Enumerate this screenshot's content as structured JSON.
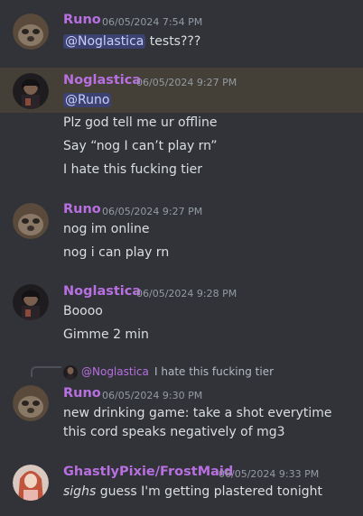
{
  "messages": [
    {
      "author": "Runo",
      "timestamp": "06/05/2024 7:54 PM",
      "mention": "@Noglastica",
      "text_after_mention": " tests???"
    },
    {
      "author": "Noglastica",
      "timestamp": "06/05/2024 9:27 PM",
      "mention": "@Runo",
      "lines": [
        "Plz god tell me ur offline",
        "Say “nog I can’t play rn”",
        "I hate this fucking tier"
      ]
    },
    {
      "author": "Runo",
      "timestamp": "06/05/2024 9:27 PM",
      "lines": [
        "nog im online",
        "nog i can play rn"
      ]
    },
    {
      "author": "Noglastica",
      "timestamp": "06/05/2024 9:28 PM",
      "lines": [
        "Boooo",
        "Gimme 2 min"
      ]
    },
    {
      "reply": {
        "author": "@Noglastica",
        "text": "I hate this fucking tier"
      },
      "author": "Runo",
      "timestamp": "06/05/2024 9:30 PM",
      "lines": [
        "new drinking game: take a shot everytime",
        "this cord speaks negatively of mg3"
      ]
    },
    {
      "author": "GhastlyPixie/FrostMaid",
      "timestamp": "06/05/2024 9:33 PM",
      "emphasis": "sighs",
      "text_after_emphasis": " guess I'm getting plastered tonight"
    }
  ],
  "colors": {
    "background": "#313338",
    "highlight": "#444037",
    "username": "#b86fe0",
    "text": "#dbdee1",
    "timestamp": "#949ba4",
    "mention_bg": "#3c4270",
    "mention_text": "#c9cdfb"
  }
}
